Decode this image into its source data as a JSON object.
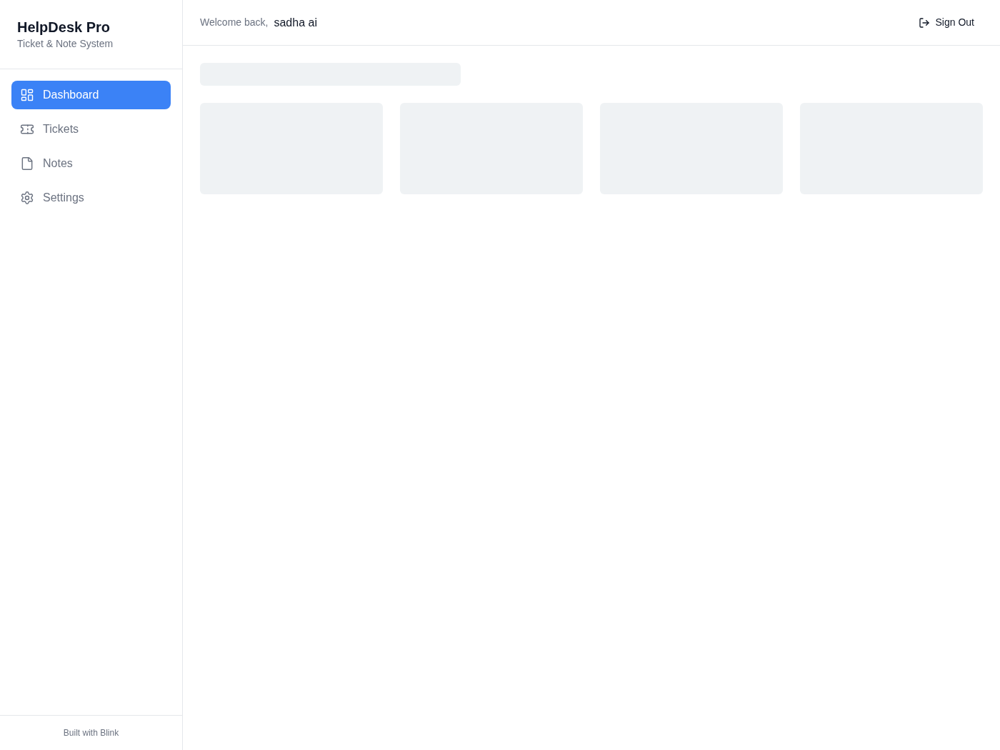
{
  "sidebar": {
    "title": "HelpDesk Pro",
    "subtitle": "Ticket & Note System",
    "items": [
      {
        "label": "Dashboard",
        "selected": true
      },
      {
        "label": "Tickets",
        "selected": false
      },
      {
        "label": "Notes",
        "selected": false
      },
      {
        "label": "Settings",
        "selected": false
      }
    ],
    "footer": "Built with Blink"
  },
  "header": {
    "greeting": "Welcome back,",
    "user_name": "sadha ai",
    "sign_out": "Sign Out"
  },
  "content": {
    "loading": true
  }
}
